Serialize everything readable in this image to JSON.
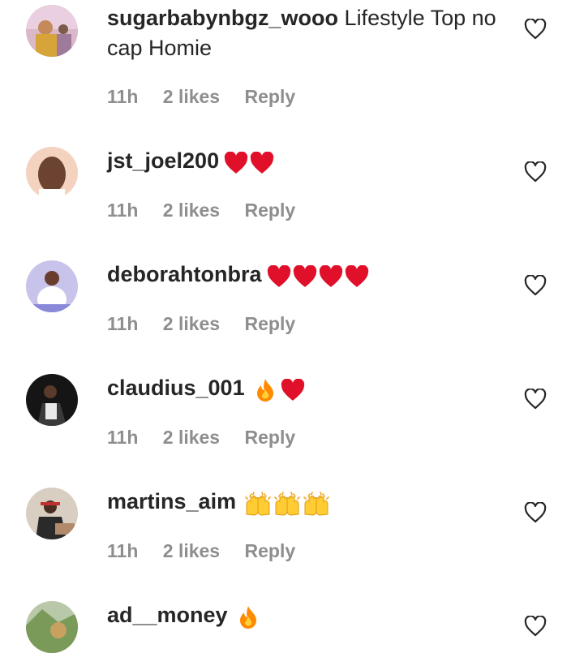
{
  "comments": [
    {
      "username": "sugarbabynbgz_wooo",
      "text": "Lifestyle Top no cap Homie",
      "emojis": [],
      "time": "11h",
      "likes": "2 likes",
      "reply": "Reply",
      "avatar_color": "#c9a27a"
    },
    {
      "username": "jst_joel200",
      "text": "",
      "emojis": [
        "red-heart",
        "red-heart"
      ],
      "time": "11h",
      "likes": "2 likes",
      "reply": "Reply",
      "avatar_color": "#e8a27c"
    },
    {
      "username": "deborahtonbra",
      "text": "",
      "emojis": [
        "red-heart",
        "red-heart",
        "red-heart",
        "red-heart"
      ],
      "time": "11h",
      "likes": "2 likes",
      "reply": "Reply",
      "avatar_color": "#b9a7e0"
    },
    {
      "username": "claudius_001",
      "text": "",
      "emojis": [
        "fire",
        "red-heart"
      ],
      "time": "11h",
      "likes": "2 likes",
      "reply": "Reply",
      "avatar_color": "#1a1a1a"
    },
    {
      "username": "martins_aim",
      "text": "",
      "emojis": [
        "raising-hands",
        "raising-hands",
        "raising-hands"
      ],
      "time": "11h",
      "likes": "2 likes",
      "reply": "Reply",
      "avatar_color": "#8a7a6a"
    },
    {
      "username": "ad__money",
      "text": "",
      "emojis": [
        "fire"
      ],
      "time": "",
      "likes": "",
      "reply": "",
      "avatar_color": "#7a9a6a"
    }
  ],
  "colors": {
    "text": "#262626",
    "meta": "#8e8e8e",
    "heart_emoji": "#e0102a",
    "fire_emoji": "#ff8a00"
  }
}
